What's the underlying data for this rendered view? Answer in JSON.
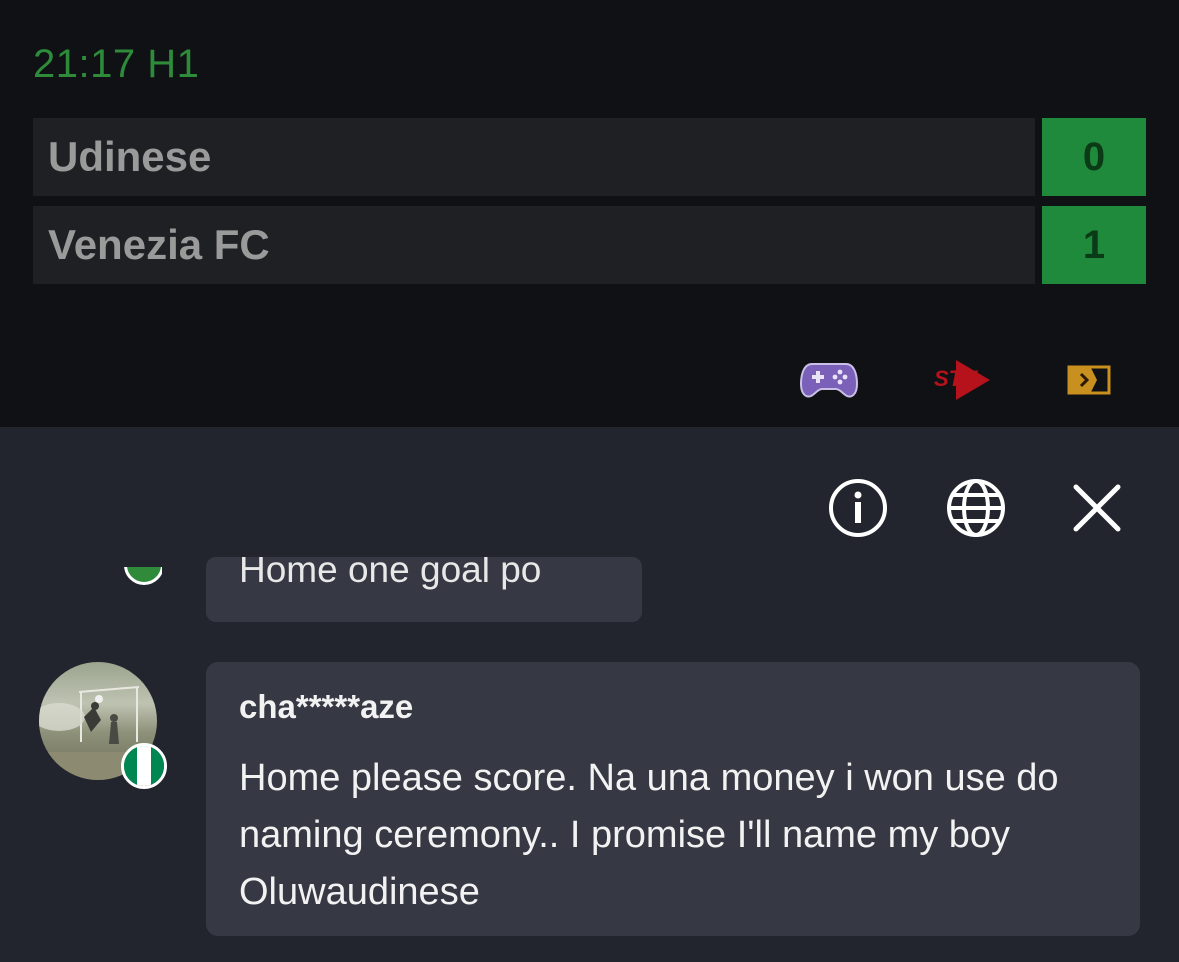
{
  "match": {
    "time": "21:17 H1",
    "home": {
      "name": "Udinese",
      "score": "0"
    },
    "away": {
      "name": "Venezia FC",
      "score": "1"
    },
    "icons": [
      "gamepad-icon",
      "stv-icon",
      "tv-icon"
    ],
    "stv_label": "STV",
    "colors": {
      "time": "#2e8b3a",
      "score_bg": "#1f8a3c",
      "gamepad": "#7a60b8",
      "stv": "#b5121b",
      "tv": "#c8901e"
    }
  },
  "chat": {
    "toolbar": [
      "info-icon",
      "globe-icon",
      "close-icon"
    ],
    "previous_message": {
      "text": "Home one goal po"
    },
    "message": {
      "username": "cha*****aze",
      "text": "Home please score. Na una money i won use do naming ceremony.. I promise I'll name my boy Oluwaudinese",
      "flag_colors": [
        "#008751",
        "#ffffff",
        "#008751"
      ]
    }
  }
}
